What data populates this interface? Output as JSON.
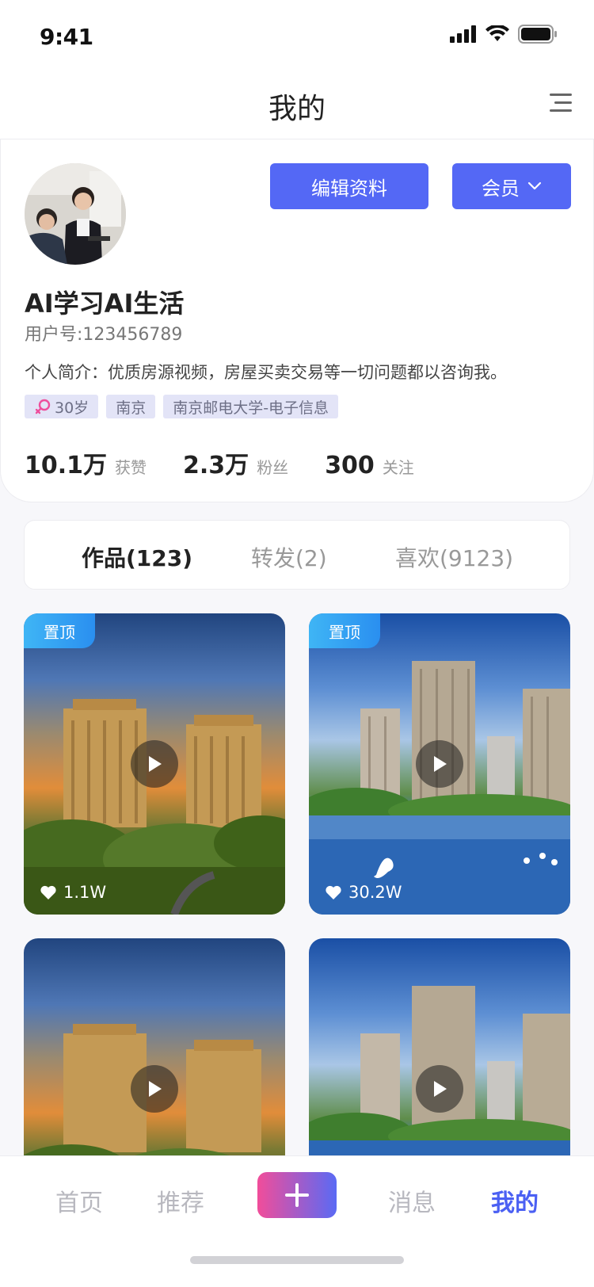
{
  "status_bar": {
    "time": "9:41"
  },
  "header": {
    "title": "我的"
  },
  "profile": {
    "edit_button": "编辑资料",
    "member_button": "会员",
    "username": "AI学习AI生活",
    "user_id": "用户号:123456789",
    "bio": "个人简介：优质房源视频，房屋买卖交易等一切问题都以咨询我。",
    "tags": {
      "age": "30岁",
      "city": "南京",
      "school": "南京邮电大学-电子信息"
    },
    "stats": [
      {
        "value": "10.1万",
        "label": "获赞"
      },
      {
        "value": "2.3万",
        "label": "粉丝"
      },
      {
        "value": "300",
        "label": "关注"
      }
    ]
  },
  "content_tabs": [
    {
      "label": "作品(123)",
      "active": true
    },
    {
      "label": "转发(2)",
      "active": false
    },
    {
      "label": "喜欢(9123)",
      "active": false
    }
  ],
  "videos": [
    {
      "pinned_label": "置顶",
      "likes": "1.1W"
    },
    {
      "pinned_label": "置顶",
      "likes": "30.2W"
    },
    {
      "pinned_label": "",
      "likes": ""
    },
    {
      "pinned_label": "",
      "likes": ""
    }
  ],
  "tabbar": {
    "items": [
      {
        "label": "首页"
      },
      {
        "label": "推荐"
      },
      {
        "label": "消息"
      },
      {
        "label": "我的"
      }
    ],
    "active": "我的"
  },
  "colors": {
    "accent": "#5468f5",
    "gradient_start": "#f14d9a",
    "gradient_end": "#5a6af4",
    "pin_blue": "#2a8ff0"
  },
  "icons": [
    "signal-icon",
    "wifi-icon",
    "battery-icon",
    "menu-icon",
    "chevron-down-icon",
    "female-icon",
    "play-icon",
    "heart-icon",
    "plus-icon"
  ]
}
